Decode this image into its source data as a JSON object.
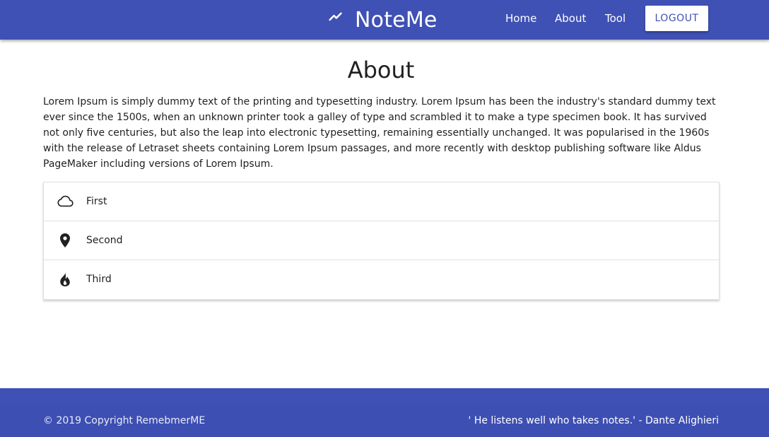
{
  "navbar": {
    "brand_title": "NoteMe",
    "brand_icon": "trending-up-icon",
    "links": [
      {
        "label": "Home"
      },
      {
        "label": "About"
      },
      {
        "label": "Tool"
      }
    ],
    "logout_label": "LOGOUT",
    "color": "#3f51b5"
  },
  "main": {
    "title": "About",
    "intro": "Lorem Ipsum is simply dummy text of the printing and typesetting industry. Lorem Ipsum has been the industry's standard dummy text ever since the 1500s, when an unknown printer took a galley of type and scrambled it to make a type specimen book. It has survived not only five centuries, but also the leap into electronic typesetting, remaining essentially unchanged. It was popularised in the 1960s with the release of Letraset sheets containing Lorem Ipsum passages, and more recently with desktop publishing software like Aldus PageMaker including versions of Lorem Ipsum.",
    "items": [
      {
        "label": "First",
        "icon": "cloud-icon"
      },
      {
        "label": "Second",
        "icon": "location-pin-icon"
      },
      {
        "label": "Third",
        "icon": "flame-icon"
      }
    ]
  },
  "footer": {
    "copyright": "© 2019 Copyright RemebmerME",
    "quote": "' He listens well who takes notes.' - Dante Alighieri"
  }
}
